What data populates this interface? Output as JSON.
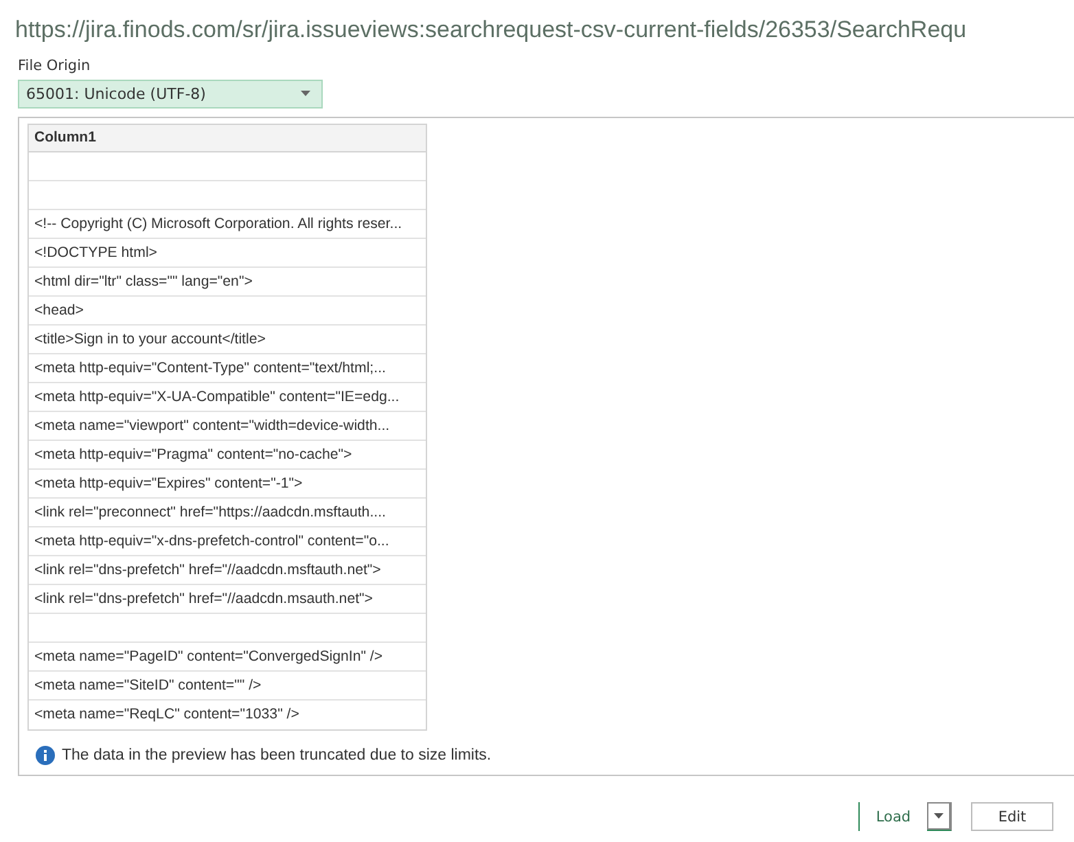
{
  "title": "https://jira.finods.com/sr/jira.issueviews:searchrequest-csv-current-fields/26353/SearchRequ",
  "file_origin": {
    "label": "File Origin",
    "value": "65001: Unicode (UTF-8)"
  },
  "table": {
    "columns": [
      "Column1"
    ],
    "rows": [
      null,
      null,
      "<!-- Copyright (C) Microsoft Corporation. All rights reser...",
      "<!DOCTYPE html>",
      "<html dir=\"ltr\" class=\"\" lang=\"en\">",
      "<head>",
      "<title>Sign in to your account</title>",
      "<meta http-equiv=\"Content-Type\" content=\"text/html;...",
      "<meta http-equiv=\"X-UA-Compatible\" content=\"IE=edg...",
      "<meta name=\"viewport\" content=\"width=device-width...",
      "<meta http-equiv=\"Pragma\" content=\"no-cache\">",
      "<meta http-equiv=\"Expires\" content=\"-1\">",
      "<link rel=\"preconnect\" href=\"https://aadcdn.msftauth....",
      "<meta http-equiv=\"x-dns-prefetch-control\" content=\"o...",
      "<link rel=\"dns-prefetch\" href=\"//aadcdn.msftauth.net\">",
      "<link rel=\"dns-prefetch\" href=\"//aadcdn.msauth.net\">",
      null,
      "<meta name=\"PageID\" content=\"ConvergedSignIn\" />",
      "<meta name=\"SiteID\" content=\"\" />",
      "<meta name=\"ReqLC\" content=\"1033\" />"
    ]
  },
  "notice": "The data in the preview has been truncated due to size limits.",
  "buttons": [
    {
      "label": "Load",
      "kind": "split"
    },
    {
      "label": "Edit",
      "kind": "plain"
    }
  ]
}
